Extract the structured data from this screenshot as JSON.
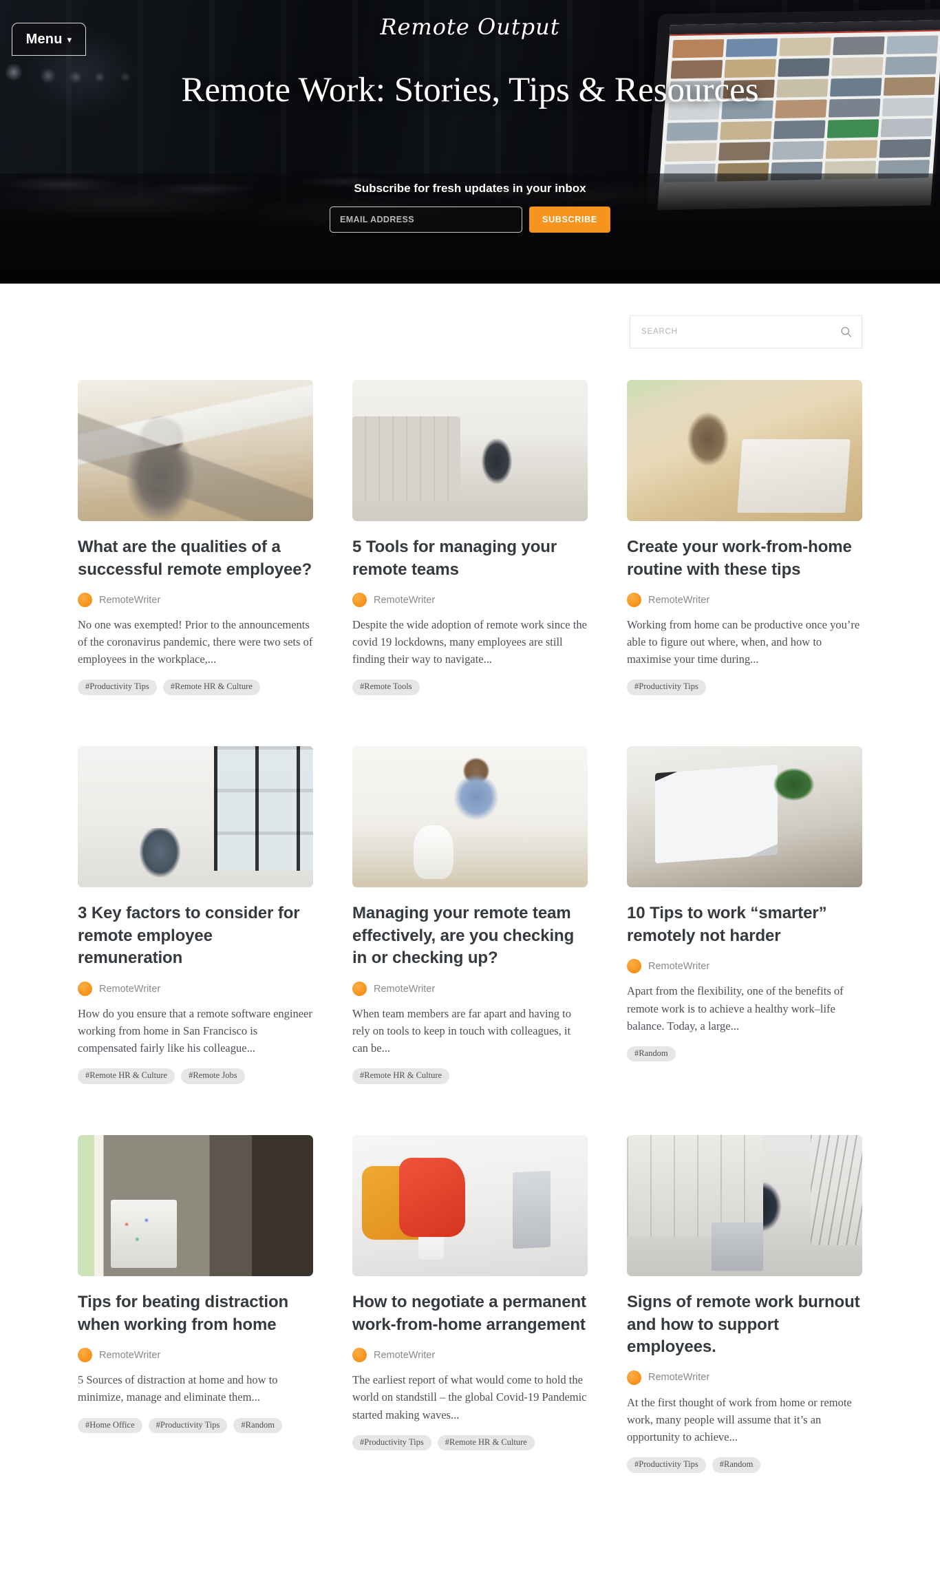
{
  "hero": {
    "menu_label": "Menu",
    "menu_chevron": "chevron-down-icon",
    "brand": "Remote Output",
    "title": "Remote Work: Stories, Tips & Resources",
    "subscribe_label": "Subscribe for fresh updates in your inbox",
    "email_placeholder": "EMAIL ADDRESS",
    "email_value": "",
    "subscribe_button": "SUBSCRIBE",
    "accent_color": "#f7941d"
  },
  "search": {
    "placeholder": "SEARCH",
    "value": "",
    "icon": "search-icon"
  },
  "posts": [
    {
      "title": "What are the qualities of a successful remote employee?",
      "author": "RemoteWriter",
      "excerpt": "No one was exempted! Prior to the announcements of the coronavirus pandemic, there were two sets of employees in the workplace,...",
      "tags": [
        "#Productivity Tips",
        "#Remote HR & Culture"
      ],
      "thumb": "man-at-desk-with-laptops"
    },
    {
      "title": "5 Tools for managing your remote teams",
      "author": "RemoteWriter",
      "excerpt": "Despite the wide adoption of remote work since the covid 19 lockdowns, many employees are still finding their way to navigate...",
      "tags": [
        "#Remote Tools"
      ],
      "thumb": "woman-on-floor-by-sofa"
    },
    {
      "title": "Create your work-from-home routine with these tips",
      "author": "RemoteWriter",
      "excerpt": "Working from home can be productive once you’re able to figure out where, when, and how to maximise your time during...",
      "tags": [
        "#Productivity Tips"
      ],
      "thumb": "woman-with-glasses-at-laptop"
    },
    {
      "title": "3 Key factors to consider for remote employee remuneration",
      "author": "RemoteWriter",
      "excerpt": "How do you ensure that a remote software engineer working from home in San Francisco is compensated fairly like his colleague...",
      "tags": [
        "#Remote HR & Culture",
        "#Remote Jobs"
      ],
      "thumb": "man-at-desk-by-window"
    },
    {
      "title": "Managing your remote team effectively, are you checking in or checking up?",
      "author": "RemoteWriter",
      "excerpt": "When team members are far apart and having to rely on tools to keep in touch with colleagues, it can be...",
      "tags": [
        "#Remote HR & Culture"
      ],
      "thumb": "woman-in-blue-shirt-at-table"
    },
    {
      "title": "10 Tips to work “smarter” remotely not harder",
      "author": "RemoteWriter",
      "excerpt": "Apart from the flexibility, one of the benefits of remote work is to achieve a healthy work–life balance. Today, a large...",
      "tags": [
        "#Random"
      ],
      "thumb": "hands-typing-on-laptop"
    },
    {
      "title": "Tips for beating distraction when working from home",
      "author": "RemoteWriter",
      "excerpt": "5 Sources of distraction at home and how to minimize, manage and eliminate them...",
      "tags": [
        "#Home Office",
        "#Productivity Tips",
        "#Random"
      ],
      "thumb": "person-with-sticker-laptop-in-booth"
    },
    {
      "title": "How to negotiate a permanent work-from-home arrangement",
      "author": "RemoteWriter",
      "excerpt": "The earliest report of what would come to hold the world on standstill – the global Covid-19 Pandemic started making waves...",
      "tags": [
        "#Productivity Tips",
        "#Remote HR & Culture"
      ],
      "thumb": "laptop-on-bed-with-pillows"
    },
    {
      "title": "Signs of remote work burnout and how to support employees.",
      "author": "RemoteWriter",
      "excerpt": "At the first thought of work from home or remote work, many people will assume that it’s an opportunity to achieve...",
      "tags": [
        "#Productivity Tips",
        "#Random"
      ],
      "thumb": "man-in-suit-outdoors-with-laptop"
    }
  ]
}
